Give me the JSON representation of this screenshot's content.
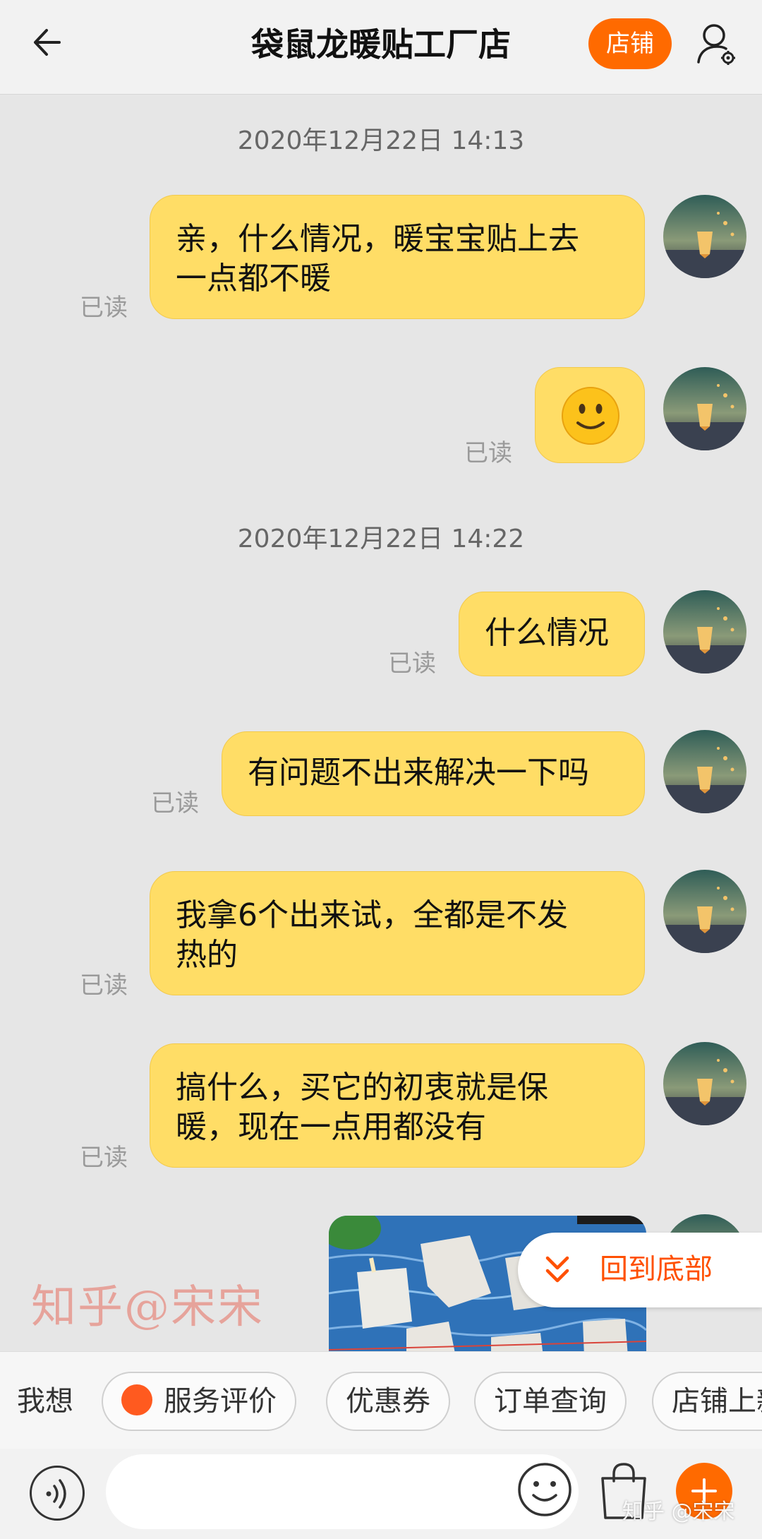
{
  "header": {
    "title": "袋鼠龙暖贴工厂店",
    "shop_button": "店铺"
  },
  "timestamps": [
    "2020年12月22日 14:13",
    "2020年12月22日 14:22"
  ],
  "messages": [
    {
      "text_lines": [
        "亲，什么情况，暖宝宝贴上去",
        "一点都不暖"
      ],
      "status": "已读"
    },
    {
      "emoji": "slightly-smiling-face",
      "status": "已读"
    },
    {
      "text": "什么情况",
      "status": "已读"
    },
    {
      "text": "有问题不出来解决一下吗",
      "status": "已读"
    },
    {
      "text_lines": [
        "我拿6个出来试，全都是不发",
        "热的"
      ],
      "status": "已读"
    },
    {
      "text_lines": [
        "搞什么，买它的初衷就是保",
        "暖，现在一点用都没有"
      ],
      "status": "已读"
    }
  ],
  "back_to_bottom": "回到底部",
  "watermark": "知乎@宋宋",
  "quickbar": {
    "label": "我想",
    "chips": [
      "服务评价",
      "优惠券",
      "订单查询",
      "店铺上新"
    ]
  },
  "input": {
    "placeholder": ""
  },
  "site_watermark": "知乎 @宋宋",
  "colors": {
    "accent": "#ff6a00",
    "bubble": "#ffdd66",
    "background": "#e6e6e6"
  }
}
